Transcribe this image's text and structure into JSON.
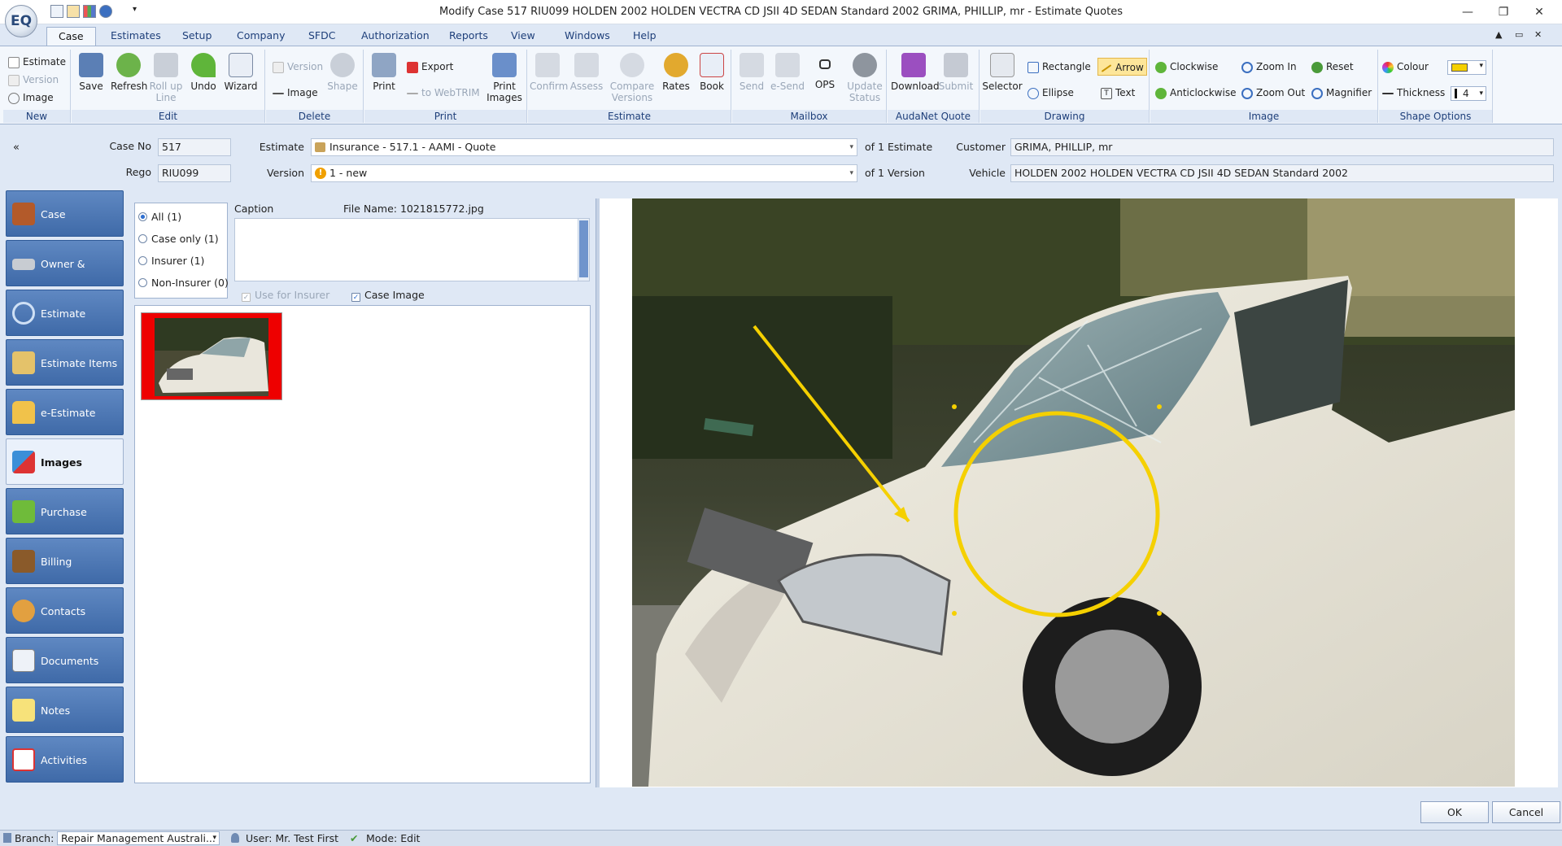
{
  "window": {
    "title": "Modify Case 517 RIU099 HOLDEN 2002 HOLDEN VECTRA CD JSII 4D SEDAN Standard 2002 GRIMA, PHILLIP, mr - Estimate Quotes",
    "logo_text": "EQ",
    "minimize": "—",
    "maximize": "❐",
    "close": "✕"
  },
  "menu_tabs": [
    "Case",
    "Estimates",
    "Setup",
    "Company",
    "SFDC",
    "Authorization",
    "Reports",
    "View",
    "Windows",
    "Help"
  ],
  "ribbon": {
    "new": {
      "label": "New",
      "estimate": "Estimate",
      "version": "Version",
      "image": "Image"
    },
    "edit": {
      "label": "Edit",
      "save": "Save",
      "refresh": "Refresh",
      "rollup": "Roll up Line",
      "undo": "Undo",
      "wizard": "Wizard"
    },
    "delete": {
      "label": "Delete",
      "version": "Version",
      "image": "Image",
      "shape": "Shape"
    },
    "print": {
      "label": "Print",
      "print": "Print",
      "export": "Export",
      "webtrim": "to WebTRIM",
      "print_images": "Print Images"
    },
    "estimate": {
      "label": "Estimate",
      "confirm": "Confirm",
      "assess": "Assess",
      "compare": "Compare Versions",
      "rates": "Rates",
      "book": "Book"
    },
    "mailbox": {
      "label": "Mailbox",
      "send": "Send",
      "esend": "e-Send",
      "ops": "OPS",
      "update_status": "Update Status"
    },
    "audanet": {
      "label": "AudaNet Quote",
      "download": "Download",
      "submit": "Submit"
    },
    "drawing": {
      "label": "Drawing",
      "selector": "Selector",
      "rectangle": "Rectangle",
      "arrow": "Arrow",
      "ellipse": "Ellipse",
      "text": "Text"
    },
    "image": {
      "label": "Image",
      "clockwise": "Clockwise",
      "anticlockwise": "Anticlockwise",
      "zoom_in": "Zoom In",
      "zoom_out": "Zoom Out",
      "reset": "Reset",
      "magnifier": "Magnifier"
    },
    "shape_options": {
      "label": "Shape Options",
      "colour": "Colour",
      "thickness": "Thickness",
      "thickness_value": "4",
      "colour_value": "#f5d000"
    }
  },
  "form": {
    "collapse": "«",
    "case_no_label": "Case No",
    "case_no": "517",
    "rego_label": "Rego",
    "rego": "RIU099",
    "estimate_label": "Estimate",
    "estimate": "Insurance - 517.1 - AAMI - Quote",
    "of_estimate": "of 1 Estimate",
    "version_label": "Version",
    "version": "1 - new",
    "of_version": "of 1 Version",
    "customer_label": "Customer",
    "customer": "GRIMA, PHILLIP, mr",
    "vehicle_label": "Vehicle",
    "vehicle": "HOLDEN 2002 HOLDEN VECTRA CD JSII 4D SEDAN Standard 2002"
  },
  "nav": [
    "Case",
    "Owner & Vehicle",
    "Estimate",
    "Estimate Items",
    "e-Estimate",
    "Images",
    "Purchase Orders",
    "Billing",
    "Contacts",
    "Documents",
    "Notes",
    "Activities"
  ],
  "images": {
    "filters": [
      "All (1)",
      "Case only (1)",
      "Insurer (1)",
      "Non-Insurer (0)"
    ],
    "caption_label": "Caption",
    "file_name": "File Name: 1021815772.jpg",
    "use_for_insurer": "Use for Insurer",
    "case_image": "Case Image"
  },
  "buttons": {
    "ok": "OK",
    "cancel": "Cancel"
  },
  "status": {
    "branch_label": "Branch:",
    "branch": "Repair Management Australi...",
    "user": "User: Mr. Test  First",
    "mode": "Mode: Edit"
  }
}
